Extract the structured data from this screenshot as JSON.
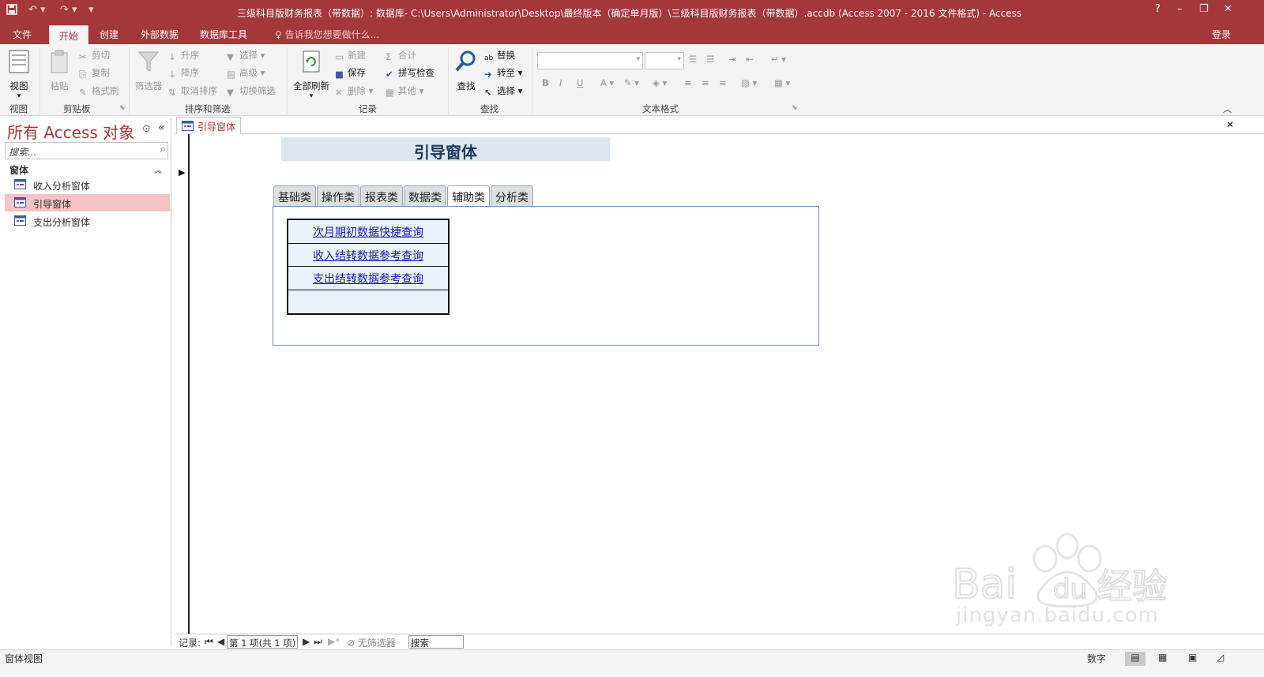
{
  "window": {
    "title": "三级科目版财务报表（带数据）: 数据库- C:\\Users\\Administrator\\Desktop\\最终版本（确定单月版）\\三级科目版财务报表（带数据）.accdb (Access 2007 - 2016 文件格式) - Access",
    "help": "?",
    "minimize": "–",
    "restore": "❐",
    "close": "✕"
  },
  "ribbon_tabs": [
    "文件",
    "开始",
    "创建",
    "外部数据",
    "数据库工具"
  ],
  "tell_me": "告诉我您想要做什么...",
  "sign_in": "登录",
  "ribbon": {
    "view": {
      "label": "视图",
      "group": "视图"
    },
    "clipboard": {
      "paste": "粘贴",
      "cut": "剪切",
      "copy": "复制",
      "format_painter": "格式刷",
      "group": "剪贴板"
    },
    "sort_filter": {
      "filter": "筛选器",
      "asc": "升序",
      "desc": "降序",
      "remove_sort": "取消排序",
      "selection": "选择",
      "advanced": "高级",
      "toggle_filter": "切换筛选",
      "group": "排序和筛选"
    },
    "records": {
      "refresh_all": "全部刷新",
      "new": "新建",
      "save": "保存",
      "delete": "删除",
      "totals": "合计",
      "spelling": "拼写检查",
      "more": "其他",
      "group": "记录"
    },
    "find": {
      "find": "查找",
      "replace": "替换",
      "goto": "转至",
      "select": "选择",
      "group": "查找"
    },
    "text_format": {
      "group": "文本格式",
      "bold": "B",
      "italic": "I",
      "underline": "U"
    }
  },
  "nav_pane": {
    "title": "所有 Access 对象",
    "search_placeholder": "搜索...",
    "section": "窗体",
    "items": [
      "收入分析窗体",
      "引导窗体",
      "支出分析窗体"
    ],
    "selected_index": 1
  },
  "document": {
    "tab_label": "引导窗体",
    "form_title": "引导窗体",
    "form_tabs": [
      "基础类",
      "操作类",
      "报表类",
      "数据类",
      "辅助类",
      "分析类"
    ],
    "active_form_tab": 4,
    "links": [
      "次月期初数据快捷查询",
      "收入结转数据参考查询",
      "支出结转数据参考查询",
      ""
    ]
  },
  "record_nav": {
    "label": "记录:",
    "position": "第 1 项(共 1 项)",
    "filter": "无筛选器",
    "search": "搜索"
  },
  "status": {
    "view_name": "窗体视图",
    "num_lock": "数字"
  },
  "watermark": {
    "logo_text": "Bai du 经验",
    "url": "jingyan.baidu.com"
  },
  "colors": {
    "accent": "#a4373a",
    "selected_nav": "#f4c3c4",
    "link": "#1a1ab8"
  }
}
